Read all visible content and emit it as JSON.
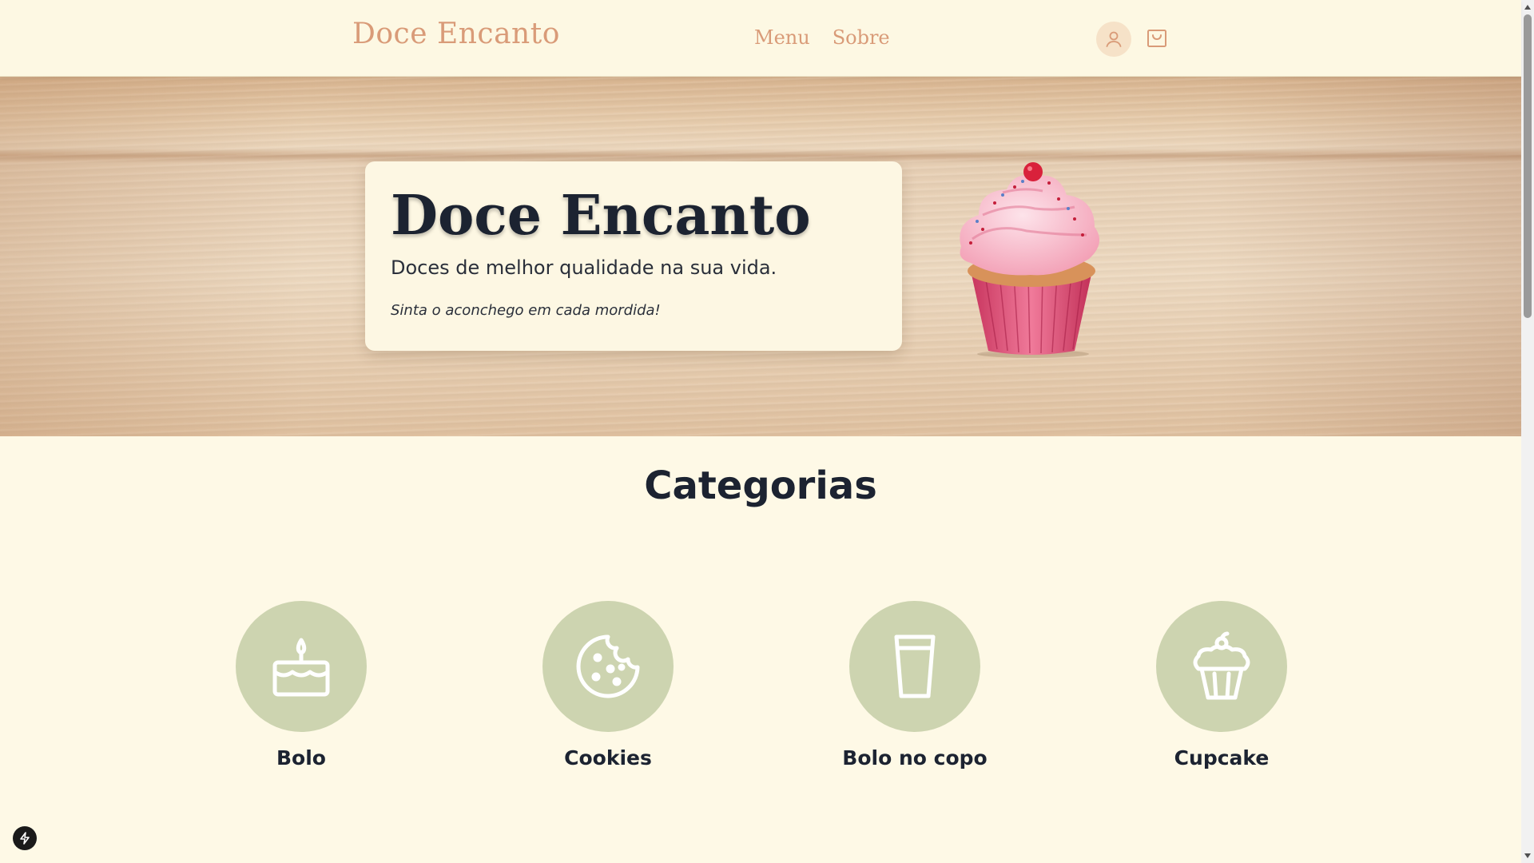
{
  "header": {
    "brand": "Doce Encanto",
    "nav": [
      {
        "label": "Menu"
      },
      {
        "label": "Sobre"
      }
    ],
    "user_icon": "user-icon",
    "cart_icon": "shopping-bag-icon"
  },
  "hero": {
    "title": "Doce Encanto",
    "subtitle": "Doces de melhor qualidade na sua vida.",
    "tagline": "Sinta o aconchego em cada mordida!"
  },
  "categories": {
    "title": "Categorias",
    "items": [
      {
        "label": "Bolo",
        "icon": "cake-icon"
      },
      {
        "label": "Cookies",
        "icon": "cookie-icon"
      },
      {
        "label": "Bolo no copo",
        "icon": "cup-icon"
      },
      {
        "label": "Cupcake",
        "icon": "cupcake-icon"
      }
    ]
  },
  "colors": {
    "background": "#fef9e6",
    "accent": "#d99b78",
    "category_circle": "#cdd4b0",
    "text": "#1c2331"
  }
}
